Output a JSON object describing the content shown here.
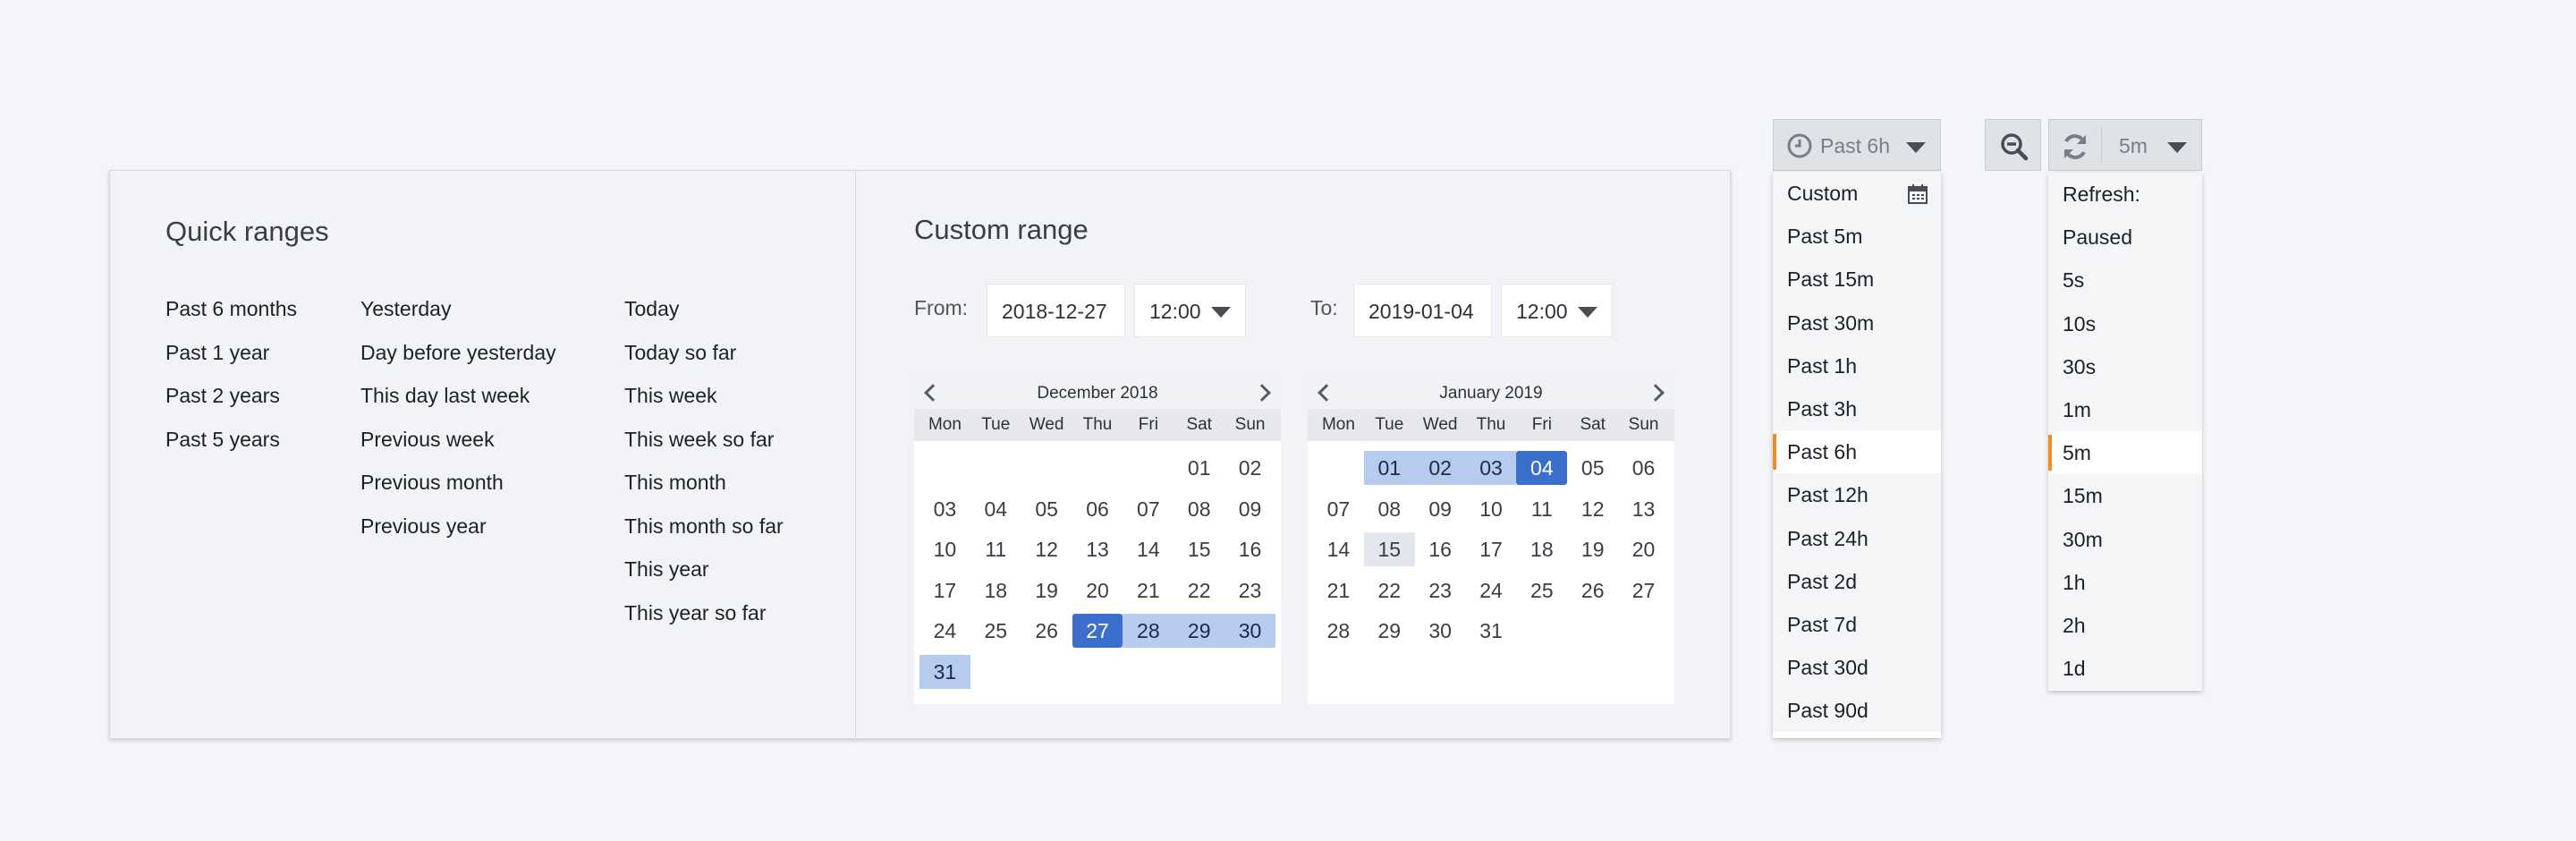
{
  "quick_ranges": {
    "title": "Quick ranges",
    "columns": [
      [
        "Past 6 months",
        "Past 1 year",
        "Past 2 years",
        "Past 5 years"
      ],
      [
        "Yesterday",
        "Day before yesterday",
        "This day last week",
        "Previous week",
        "Previous month",
        "Previous year"
      ],
      [
        "Today",
        "Today so far",
        "This week",
        "This week so far",
        "This month",
        "This month so far",
        "This year",
        "This year so far"
      ]
    ]
  },
  "custom_range": {
    "title": "Custom range",
    "from_label": "From:",
    "from_date": "2018-12-27",
    "from_time": "12:00",
    "to_label": "To:",
    "to_date": "2019-01-04",
    "to_time": "12:00"
  },
  "calendars": [
    {
      "title": "December 2018",
      "weekdays": [
        "Mon",
        "Tue",
        "Wed",
        "Thu",
        "Fri",
        "Sat",
        "Sun"
      ],
      "days": [
        "",
        "",
        "",
        "",
        "",
        "01",
        "02",
        "03",
        "04",
        "05",
        "06",
        "07",
        "08",
        "09",
        "10",
        "11",
        "12",
        "13",
        "14",
        "15",
        "16",
        "17",
        "18",
        "19",
        "20",
        "21",
        "22",
        "23",
        "24",
        "25",
        "26",
        "27",
        "28",
        "29",
        "30",
        "31"
      ],
      "selected": [
        "27"
      ],
      "in_range": [
        "28",
        "29",
        "30",
        "31"
      ],
      "today": []
    },
    {
      "title": "January 2019",
      "weekdays": [
        "Mon",
        "Tue",
        "Wed",
        "Thu",
        "Fri",
        "Sat",
        "Sun"
      ],
      "days": [
        "",
        "01",
        "02",
        "03",
        "04",
        "05",
        "06",
        "07",
        "08",
        "09",
        "10",
        "11",
        "12",
        "13",
        "14",
        "15",
        "16",
        "17",
        "18",
        "19",
        "20",
        "21",
        "22",
        "23",
        "24",
        "25",
        "26",
        "27",
        "28",
        "29",
        "30",
        "31"
      ],
      "selected": [
        "04"
      ],
      "in_range": [
        "01",
        "02",
        "03"
      ],
      "today": [
        "15"
      ]
    }
  ],
  "time_button": {
    "label": "Past 6h",
    "icon": "clock-icon"
  },
  "zoom_button": {
    "icon": "zoom-out-icon"
  },
  "refresh_button": {
    "label": "5m",
    "icon": "refresh-icon"
  },
  "time_menu": {
    "header": "Custom",
    "header_icon": "calendar-icon",
    "items": [
      "Past 5m",
      "Past 15m",
      "Past 30m",
      "Past 1h",
      "Past 3h",
      "Past 6h",
      "Past 12h",
      "Past 24h",
      "Past 2d",
      "Past 7d",
      "Past 30d",
      "Past 90d"
    ],
    "active": "Past 6h"
  },
  "refresh_menu": {
    "header": "Refresh:",
    "items": [
      "Paused",
      "5s",
      "10s",
      "30s",
      "1m",
      "5m",
      "15m",
      "30m",
      "1h",
      "2h",
      "1d"
    ],
    "active": "5m"
  },
  "colors": {
    "selected_day": "#3c6fcd",
    "range_day": "#b7cbee",
    "active_marker": "#f08a2a"
  }
}
